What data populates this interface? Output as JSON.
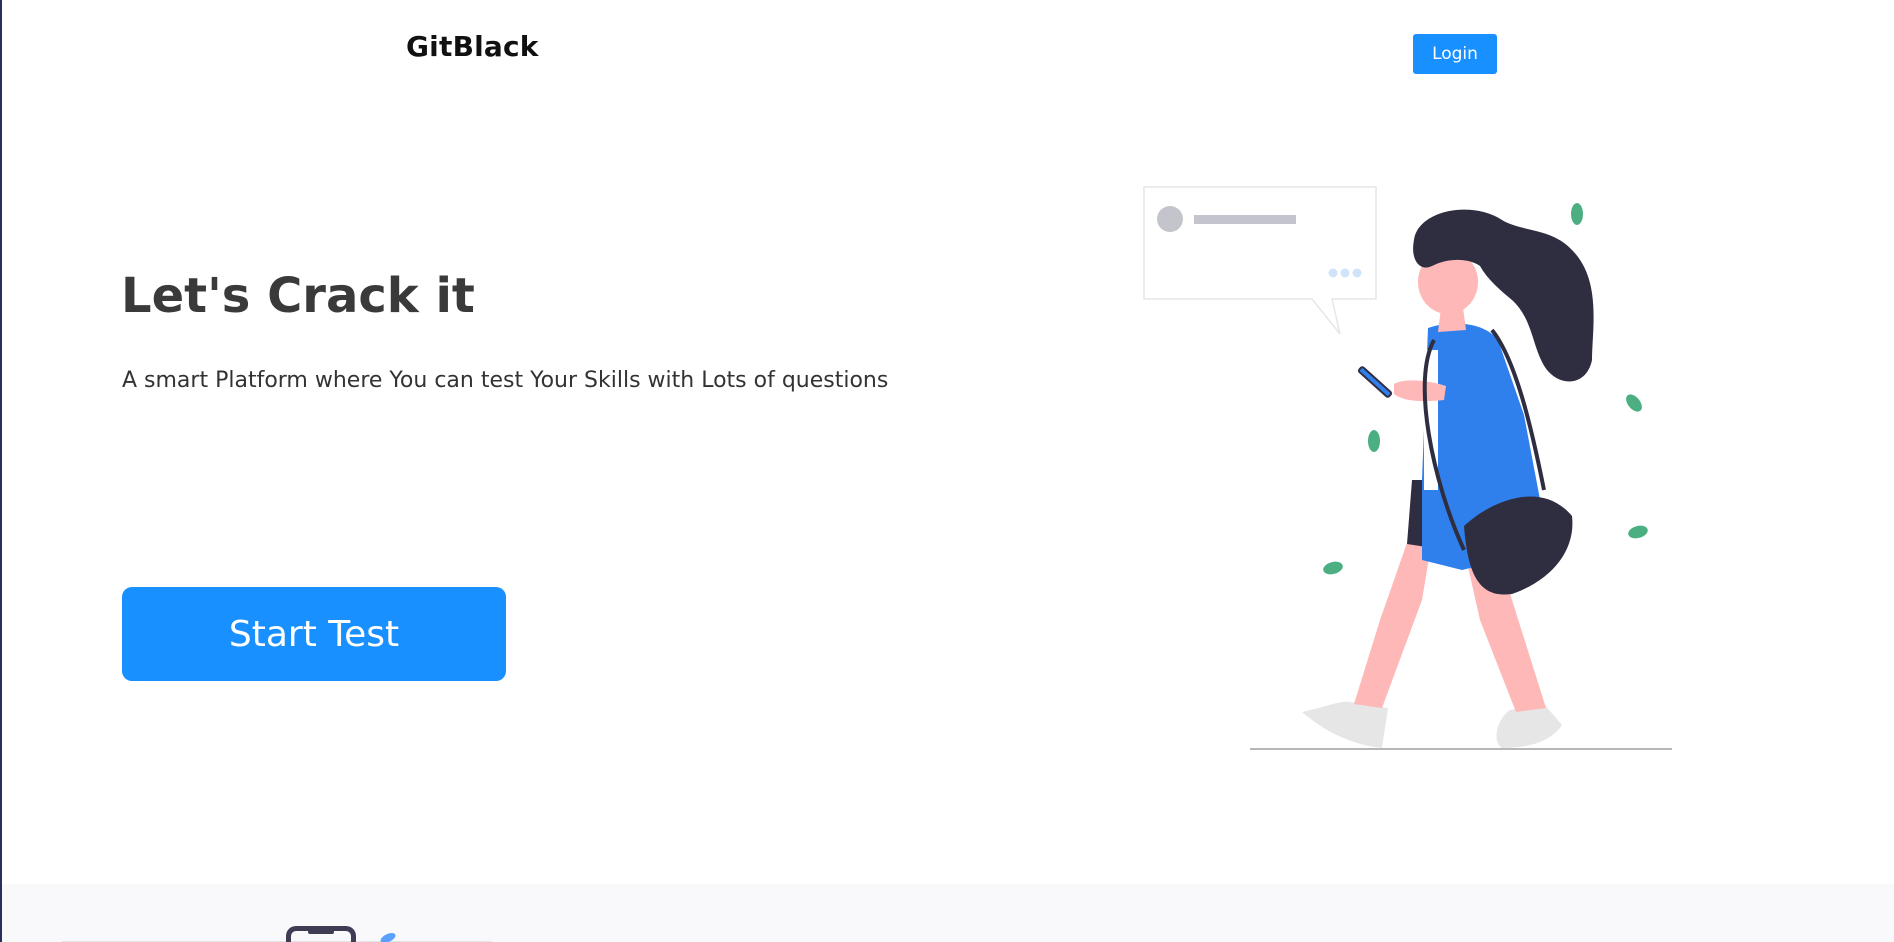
{
  "header": {
    "brand": "GitBlack",
    "login_label": "Login"
  },
  "hero": {
    "title": "Let's Crack it",
    "subtitle": "A smart Platform where You can test Your Skills with Lots of questions",
    "start_label": "Start Test"
  },
  "colors": {
    "primary": "#1890ff",
    "heading": "#3a3a3a",
    "hair": "#2f2e41",
    "skin": "#ffb8b8",
    "dress": "#2f80ed",
    "leaf": "#4caf82",
    "bubble_border": "#e6e6e6"
  },
  "illustration": {
    "name": "woman-walking-with-phone-illustration"
  }
}
